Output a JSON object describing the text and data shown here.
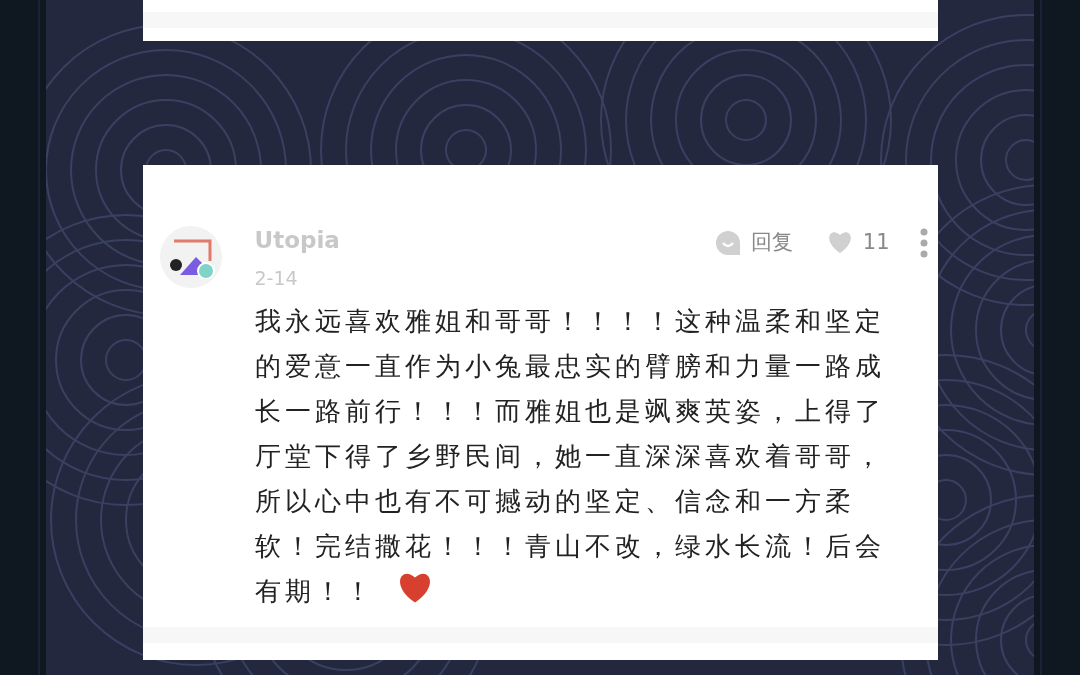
{
  "comment": {
    "author": "Utopia",
    "date": "2-14",
    "reply_label": "回复",
    "likes": "11",
    "liked": false,
    "text": "我永远喜欢雅姐和哥哥！！！！这种温柔和坚定的爱意一直作为小兔最忠实的臂膀和力量一路成长一路前行！！！而雅姐也是飒爽英姿，上得了厅堂下得了乡野民间，她一直深深喜欢着哥哥，所以心中也有不可撼动的坚定、信念和一方柔软！完结撒花！！！青山不改，绿水长流！后会有期！！"
  }
}
